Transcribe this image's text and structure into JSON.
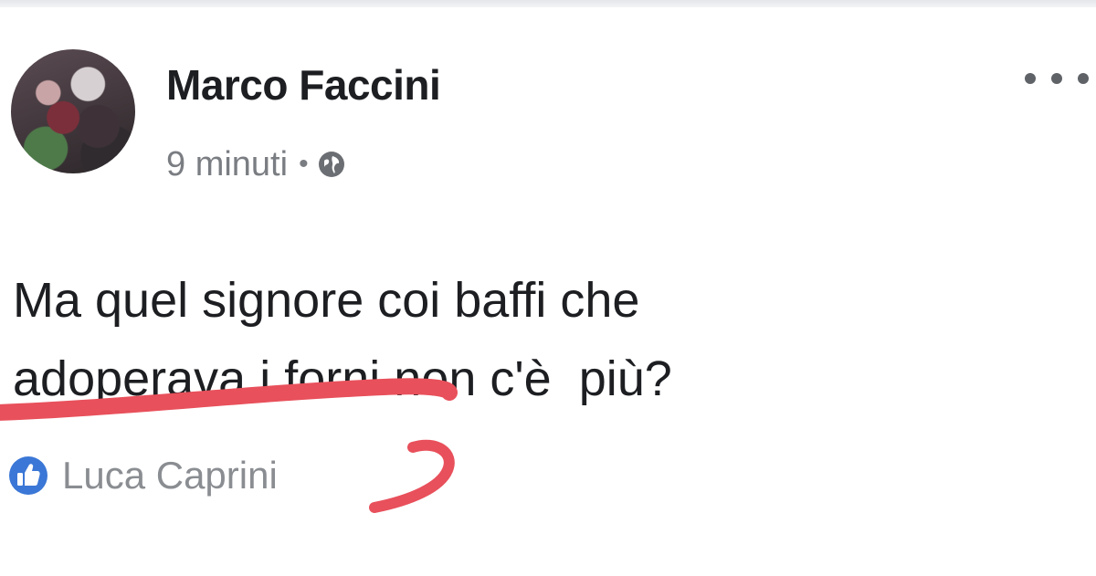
{
  "post": {
    "author": "Marco Faccini",
    "timestamp": "9 minuti",
    "separator": "•",
    "privacy_icon": "globe-icon",
    "more_icon": "more-options-icon",
    "text_lines": [
      "Ma quel signore coi baffi che",
      "adoperava i forni non c'è  più?"
    ],
    "reaction": {
      "icon": "like-icon",
      "name": "Luca Caprini"
    }
  },
  "colors": {
    "annotation_red": "#e8505b",
    "like_blue": "#3b77d6",
    "meta_gray": "#7a7d82"
  }
}
